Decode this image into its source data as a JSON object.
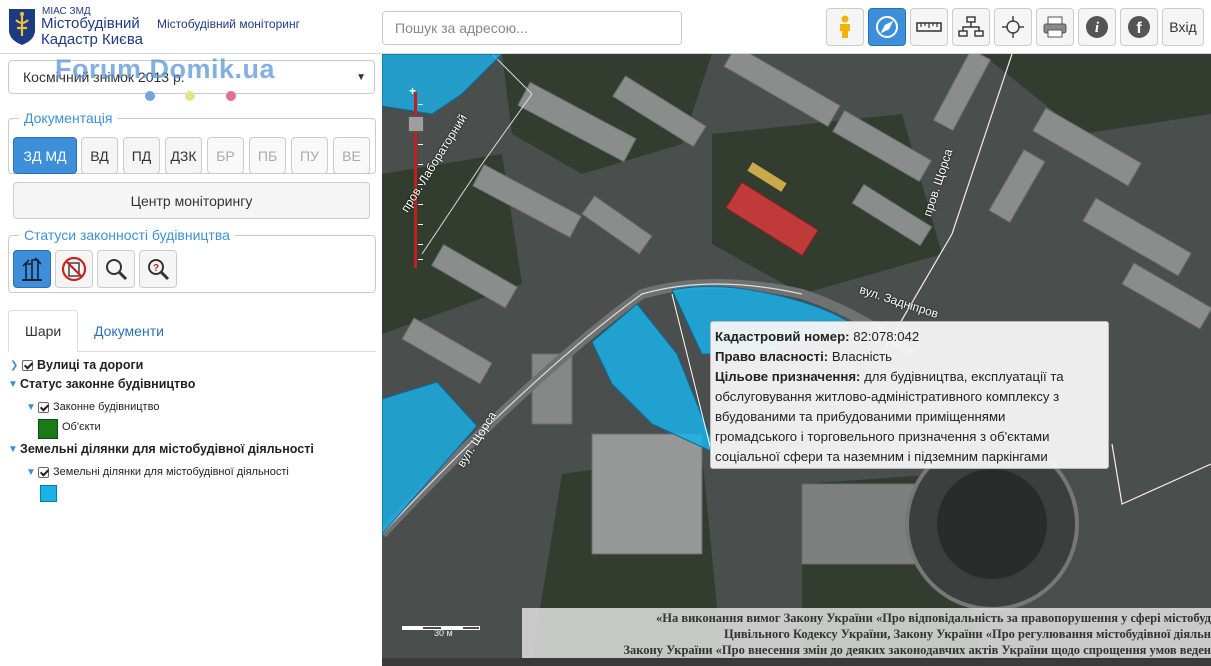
{
  "header": {
    "brand_small": "МІАС ЗМД",
    "brand_line1": "Містобудівний",
    "brand_line2": "Кадастр Києва",
    "brand_sub": "Містобудівний моніторинг",
    "search_placeholder": "Пошук за адресою...",
    "toolbar": [
      "person-icon",
      "compass-icon",
      "ruler-icon",
      "network-icon",
      "crosshair-icon",
      "print-icon",
      "info-icon",
      "facebook-icon"
    ],
    "login_label": "Вхід"
  },
  "sidebar": {
    "year_select": "Космічний знімок 2013 р.",
    "watermark": "Forum.Domik.ua",
    "documentation": {
      "legend": "Документація",
      "buttons": [
        {
          "label": "ЗД МД",
          "state": "active"
        },
        {
          "label": "ВД",
          "state": "normal"
        },
        {
          "label": "ПД",
          "state": "normal"
        },
        {
          "label": "ДЗК",
          "state": "normal"
        },
        {
          "label": "БР",
          "state": "disabled"
        },
        {
          "label": "ПБ",
          "state": "disabled"
        },
        {
          "label": "ПУ",
          "state": "disabled"
        },
        {
          "label": "ВЕ",
          "state": "disabled"
        }
      ]
    },
    "monitoring_center_label": "Центр моніторингу",
    "statuses": {
      "legend": "Статуси законності будівництва"
    },
    "tabs": {
      "layers": "Шари",
      "documents": "Документи"
    },
    "tree": {
      "streets": "Вулиці та дороги",
      "legal_status": "Статус законне будівництво",
      "legal_construction": "Законне будівництво",
      "objects": "Об'єкти",
      "land_plots_group": "Земельні ділянки для містобудівної діяльності",
      "land_plots": "Земельні ділянки для містобудівної діяльності"
    },
    "colors": {
      "objects": "#1a7a1a",
      "plots": "#1ab0e8"
    }
  },
  "map": {
    "streets": {
      "laboratorny": "пров. Лабораторний",
      "shchorsa_lane": "пров. Щорса",
      "zadniprovskoho": "вул. Задніпров",
      "shchorsa": "вул. Щорса"
    },
    "scale_label": "30",
    "scale_unit": "м",
    "popup": {
      "cadastral_label": "Кадастровий номер:",
      "cadastral_value": "82:078:042",
      "ownership_label": "Право власності:",
      "ownership_value": "Власність",
      "purpose_label": "Цільове призначення:",
      "purpose_lines": [
        "для будівництва, експлуатації та",
        "обслуговування житлово-адміністративного комплексу з",
        "вбудованими та прибудованими приміщеннями",
        "громадського і торговельного призначення з об'єктами",
        "соціальної сфери та наземним і підземним паркінгами"
      ]
    },
    "legal_lines": [
      "«На виконання вимог Закону України «Про відповідальність за правопорушення у сфері містобуд",
      "Цивільного Кодексу України, Закону України «Про регулювання містобудівної діяльн",
      "Закону України «Про внесення змін до деяких законодавчих актів України щодо спрощення умов веден"
    ]
  }
}
